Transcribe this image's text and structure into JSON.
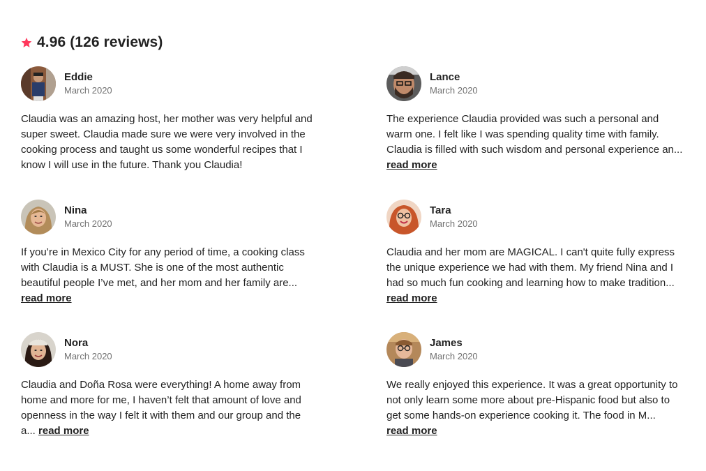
{
  "rating": {
    "score_text": "4.96 (126 reviews)",
    "star_color": "#FF385C"
  },
  "reviews": [
    {
      "name": "Eddie",
      "date": "March 2020",
      "text": "Claudia was an amazing host, her mother was very helpful and super sweet. Claudia made sure we were very involved in the cooking process and taught us some wonderful recipes that I know I will use in the future. Thank you Claudia!",
      "read_more": ""
    },
    {
      "name": "Lance",
      "date": "March 2020",
      "text": "The experience Claudia provided was such a personal and warm one. I felt like I was spending quality time with family. Claudia is filled with such wisdom and personal experience an...",
      "read_more": "read more"
    },
    {
      "name": "Nina",
      "date": "March 2020",
      "text": "If you’re in Mexico City for any period of time, a cooking class with Claudia is a MUST. She is one of the most authentic beautiful people I’ve met, and her mom and her family are...",
      "read_more": "read more"
    },
    {
      "name": "Tara",
      "date": "March 2020",
      "text": "Claudia and her mom are MAGICAL. I can't quite fully express the unique experience we had with them. My friend Nina and I had so much fun cooking and learning how to make tradition...",
      "read_more": "read more"
    },
    {
      "name": "Nora",
      "date": "March 2020",
      "text": "Claudia and Doña Rosa were everything! A home away from home and more for me, I haven’t felt that amount of love and openness in the way I felt it with them and our group and the a...",
      "read_more": "read more"
    },
    {
      "name": "James",
      "date": "March 2020",
      "text": "We really enjoyed this experience. It was a great opportunity to not only learn some more about pre-Hispanic food but also to get some hands-on experience cooking it. The food in M...",
      "read_more": "read more"
    }
  ]
}
